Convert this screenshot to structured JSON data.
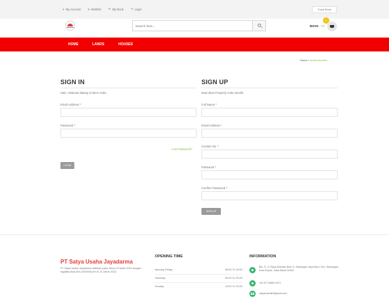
{
  "topbar": {
    "links": [
      {
        "label": "My Account",
        "icon": "user-icon",
        "glyph": "●"
      },
      {
        "label": "Wishlist",
        "icon": "heart-icon",
        "glyph": "♥"
      },
      {
        "label": "My Book",
        "icon": "star-icon",
        "glyph": "★"
      },
      {
        "label": "Login",
        "icon": "login-icon",
        "glyph": "➔"
      }
    ],
    "track_label": "Track Book"
  },
  "header": {
    "search_placeholder": "Search here...",
    "cart_label": "BOOK",
    "cart_amount": "- ₹0",
    "cart_count": "0"
  },
  "nav": {
    "items": [
      "HOME",
      "LANDS",
      "HOUSES"
    ]
  },
  "breadcrumb": {
    "home": "Home",
    "sep": "/",
    "current": "Authentication"
  },
  "signin": {
    "title": "SIGN IN",
    "intro": "Halo, Selamat datang di akun Anda.",
    "email_label": "Email Address",
    "password_label": "Password",
    "required": "*",
    "lost_password": "Lost Password?",
    "button": "LOGIN"
  },
  "signup": {
    "title": "SIGN UP",
    "intro": "Buat akun Property Anda sendiri.",
    "fields": [
      {
        "label": "Full Name"
      },
      {
        "label": "Email Address"
      },
      {
        "label": "Contact No."
      },
      {
        "label": "Password"
      },
      {
        "label": "Confirm Password"
      }
    ],
    "required": "*",
    "button": "SIGN UP"
  },
  "footer": {
    "company": "PT Satya Usaha Jayadarma",
    "description": "PT Satya Usaha Jayadarma didirikan pada Tahun 22 Maret 2004 dengan legalitas Akta AHU-0000006.AH.01.01.Tahun 2022.",
    "hours_title": "OPENING TIME",
    "hours": [
      {
        "day": "Monday-Friday",
        "time": "08:00 To 18:00"
      },
      {
        "day": "Saturday",
        "time": "09:00 To 20:00"
      },
      {
        "day": "Sunday",
        "time": "10:00 To 20:00"
      }
    ],
    "info_title": "INFORMATION",
    "address": "Blk. G, Jl. Raya Muchtar Blok G, Sawangan Jaya Baru, Kec. Sawangan, Kota Depok, Jawa Barat 16434",
    "phone": "+62 877-8880-9471",
    "email": "satyamandiri@gmail.com"
  }
}
